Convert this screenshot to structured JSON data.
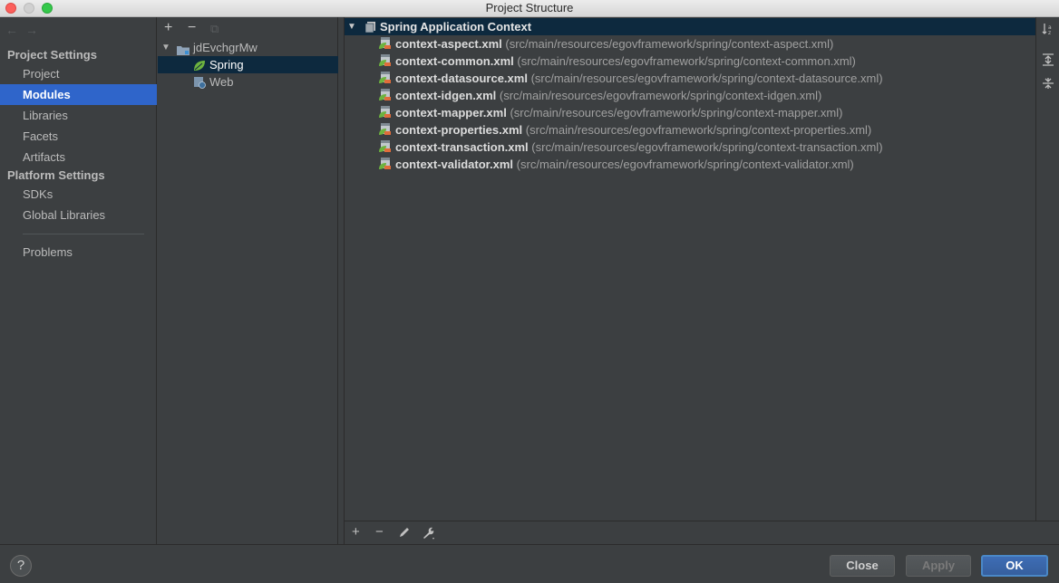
{
  "window": {
    "title": "Project Structure"
  },
  "nav": {
    "back_glyph": "←",
    "forward_glyph": "→",
    "project_settings_heading": "Project Settings",
    "project_settings_items": [
      {
        "label": "Project"
      },
      {
        "label": "Modules"
      },
      {
        "label": "Libraries"
      },
      {
        "label": "Facets"
      },
      {
        "label": "Artifacts"
      }
    ],
    "platform_settings_heading": "Platform Settings",
    "platform_settings_items": [
      {
        "label": "SDKs"
      },
      {
        "label": "Global Libraries"
      }
    ],
    "problems_label": "Problems",
    "selected": "Modules"
  },
  "module_tree": {
    "toolbar": {
      "add": "+",
      "remove": "−",
      "copy": "⧉"
    },
    "root": {
      "label": "jdEvchgrMw"
    },
    "children": [
      {
        "label": "Spring"
      },
      {
        "label": "Web"
      }
    ],
    "selected": "Spring"
  },
  "spring_context": {
    "header_label": "Spring Application Context",
    "files": [
      {
        "name": "context-aspect.xml",
        "path": "(src/main/resources/egovframework/spring/context-aspect.xml)"
      },
      {
        "name": "context-common.xml",
        "path": "(src/main/resources/egovframework/spring/context-common.xml)"
      },
      {
        "name": "context-datasource.xml",
        "path": "(src/main/resources/egovframework/spring/context-datasource.xml)"
      },
      {
        "name": "context-idgen.xml",
        "path": "(src/main/resources/egovframework/spring/context-idgen.xml)"
      },
      {
        "name": "context-mapper.xml",
        "path": "(src/main/resources/egovframework/spring/context-mapper.xml)"
      },
      {
        "name": "context-properties.xml",
        "path": "(src/main/resources/egovframework/spring/context-properties.xml)"
      },
      {
        "name": "context-transaction.xml",
        "path": "(src/main/resources/egovframework/spring/context-transaction.xml)"
      },
      {
        "name": "context-validator.xml",
        "path": "(src/main/resources/egovframework/spring/context-validator.xml)"
      }
    ],
    "bottom_toolbar": {
      "add": "+",
      "remove": "−"
    }
  },
  "footer": {
    "help_label": "?",
    "close_label": "Close",
    "apply_label": "Apply",
    "ok_label": "OK"
  },
  "colors": {
    "background": "#3c3f41",
    "selection_blue": "#2f65ca",
    "tree_selection": "#0d293e",
    "ok_button": "#365f9e"
  }
}
